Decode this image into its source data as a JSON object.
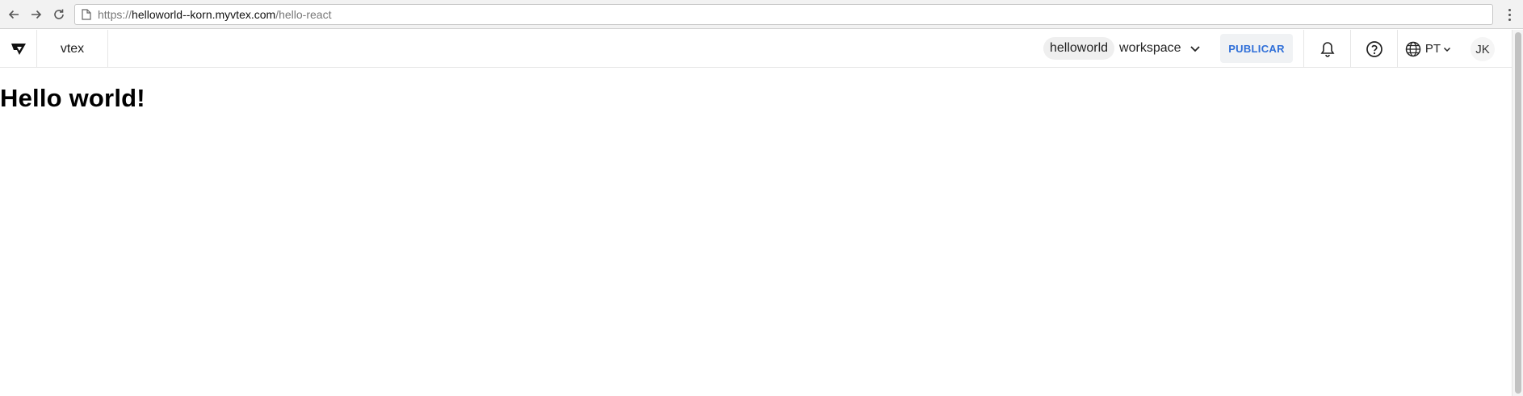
{
  "browser": {
    "url_scheme": "https://",
    "url_host": "helloworld--korn.myvtex.com",
    "url_path": "/hello-react"
  },
  "topbar": {
    "account": "vtex",
    "workspace_name": "helloworld",
    "workspace_label": "workspace",
    "publish_label": "PUBLICAR",
    "language": "PT",
    "user_initials": "JK"
  },
  "content": {
    "heading": "Hello world!"
  },
  "colors": {
    "accent": "#2f6fd8",
    "publish_bg": "#f0f2f4",
    "pill_bg": "#efefef"
  },
  "icons": [
    "back-arrow-icon",
    "forward-arrow-icon",
    "reload-icon",
    "page-icon",
    "vtex-logo-icon",
    "chevron-down-icon",
    "bell-icon",
    "help-icon",
    "globe-icon",
    "menu-dots-icon"
  ]
}
